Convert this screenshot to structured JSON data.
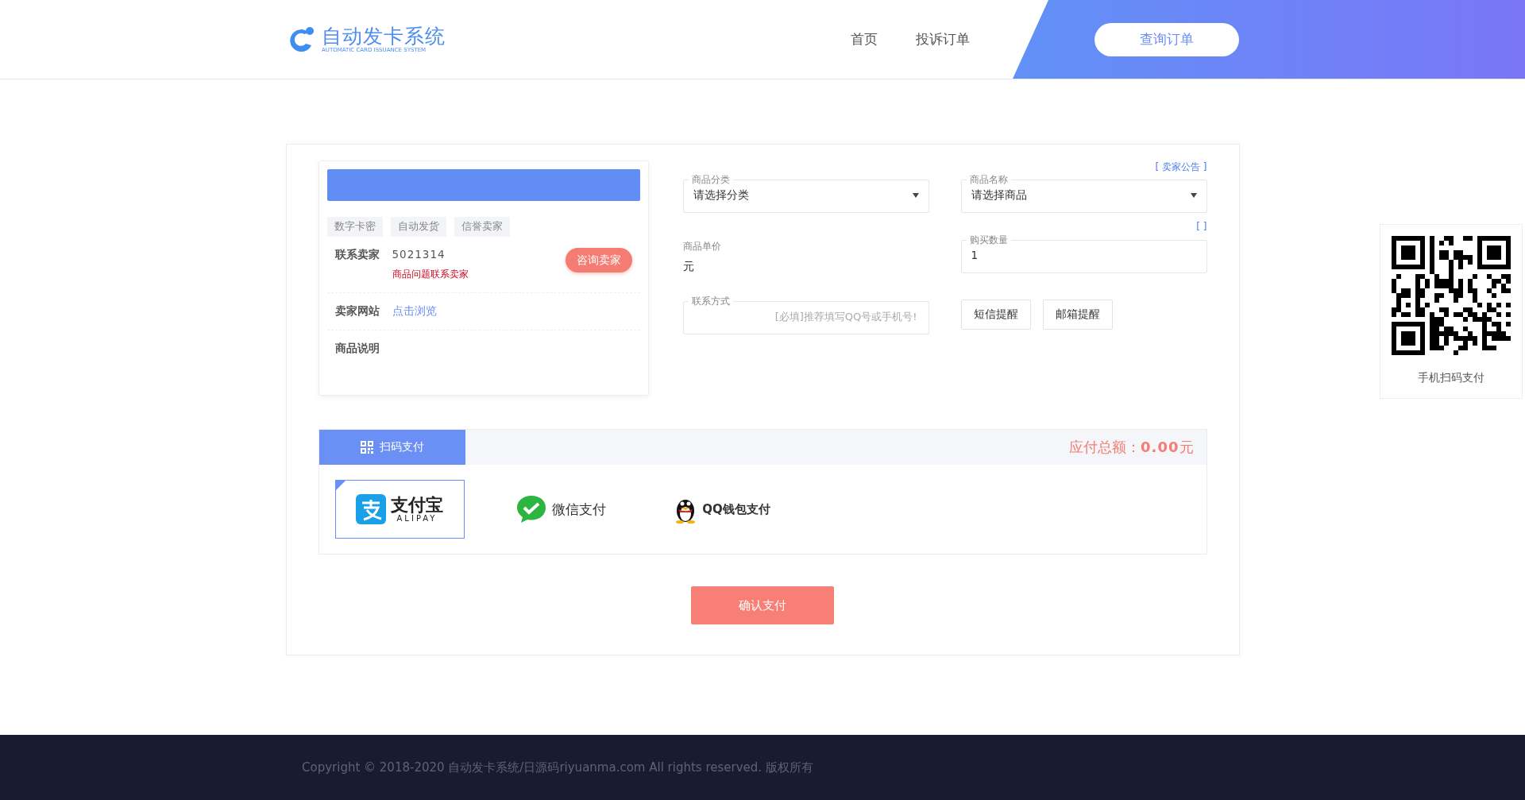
{
  "header": {
    "logo": {
      "title": "自动发卡系统",
      "subtitle": "AUTOMATIC CARD ISSUANCE SYSTEM"
    },
    "nav": [
      {
        "label": "首页"
      },
      {
        "label": "投诉订单"
      }
    ],
    "query_button": "查询订单"
  },
  "product": {
    "tags": [
      "数字卡密",
      "自动发货",
      "信誉卖家"
    ],
    "contact": {
      "label": "联系卖家",
      "value": "5021314",
      "note": "商品问题联系卖家",
      "button": "咨询卖家"
    },
    "website": {
      "label": "卖家网站",
      "link": "点击浏览"
    },
    "description": {
      "label": "商品说明"
    }
  },
  "form": {
    "notice_link": "[ 卖家公告 ]",
    "category": {
      "label": "商品分类",
      "value": "请选择分类"
    },
    "product": {
      "label": "商品名称",
      "value": "请选择商品"
    },
    "price": {
      "label": "商品单价",
      "value": "元"
    },
    "quantity_link": "[ ]",
    "quantity": {
      "label": "购买数量",
      "value": "1"
    },
    "contact": {
      "label": "联系方式",
      "placeholder": "[必填]推荐填写QQ号或手机号!"
    },
    "reminders": [
      "短信提醒",
      "邮箱提醒"
    ]
  },
  "payment": {
    "tab": "扫码支付",
    "total_label": "应付总额：",
    "total_value": "0.00",
    "total_unit": "元",
    "methods": [
      {
        "kind": "alipay",
        "name": "支付宝",
        "subname": "ALIPAY",
        "selected": true
      },
      {
        "kind": "wechat",
        "name": "微信支付",
        "selected": false
      },
      {
        "kind": "qq",
        "name": "QQ钱包支付",
        "selected": false
      }
    ],
    "confirm": "确认支付"
  },
  "qr_panel": {
    "caption": "手机扫码支付"
  },
  "footer": {
    "copyright": "Copyright © 2018-2020 自动发卡系统/日源码riyuanma.com All rights reserved. 版权所有"
  }
}
